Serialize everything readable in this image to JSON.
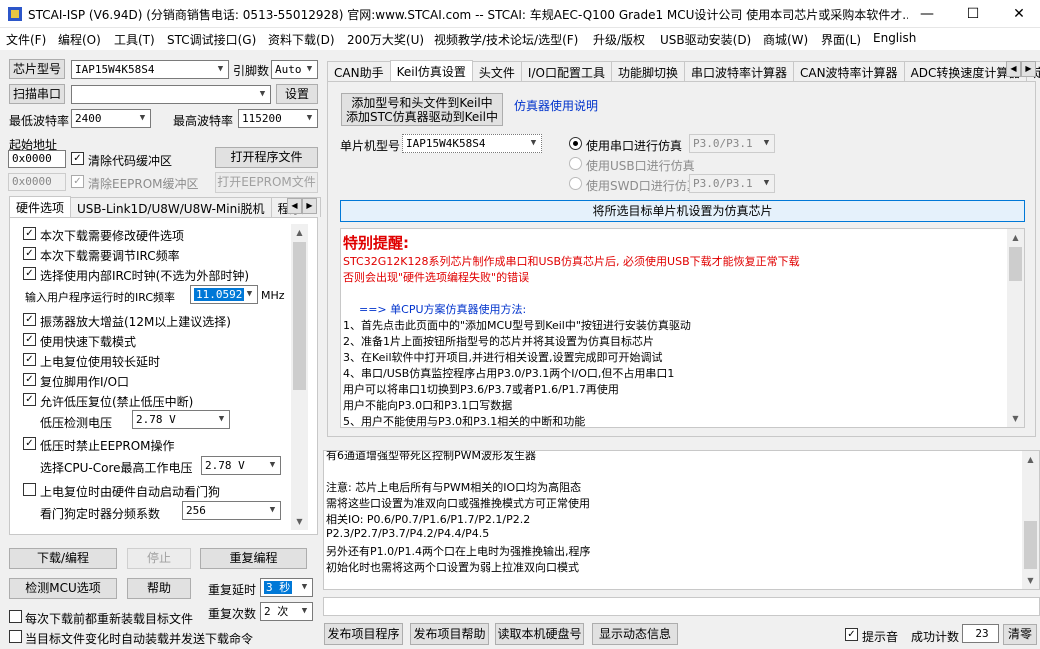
{
  "title": "STCAI-ISP (V6.94D) (分销商销售电话: 0513-55012928) 官网:www.STCAI.com  -- STCAI: 车规AEC-Q100 Grade1 MCU设计公司 使用本司芯片或采购本软件才...",
  "window_buttons": {
    "min": "—",
    "max": "☐",
    "close": "✕"
  },
  "menu": [
    "文件(F)",
    "编程(O)",
    "工具(T)",
    "STC调试接口(G)",
    "资料下载(D)",
    "200万大奖(U)",
    "视频教学/技术论坛/选型(F)",
    "升级/版权",
    "USB驱动安装(D)",
    "商城(W)",
    "界面(L)",
    "English"
  ],
  "left": {
    "chip_label": "芯片型号",
    "chip_value": "IAP15W4K58S4",
    "pin_label": "引脚数",
    "pin_value": "Auto",
    "scan_btn": "扫描串口",
    "port_value": "",
    "settings_btn": "设置",
    "min_baud_label": "最低波特率",
    "min_baud_value": "2400",
    "max_baud_label": "最高波特率",
    "max_baud_value": "115200",
    "start_addr_label": "起始地址",
    "addr1": "0x0000",
    "clear_code": "清除代码缓冲区",
    "open_prog_btn": "打开程序文件",
    "addr2": "0x0000",
    "clear_eeprom": "清除EEPROM缓冲区",
    "open_eeprom_btn": "打开EEPROM文件",
    "tabs": [
      "硬件选项",
      "USB-Link1D/U8W/U8W-Mini脱机",
      "程序加"
    ],
    "hw": {
      "opt1": "本次下载需要修改硬件选项",
      "opt2": "本次下载需要调节IRC频率",
      "opt3": "选择使用内部IRC时钟(不选为外部时钟)",
      "irc_label": "输入用户程序运行时的IRC频率",
      "irc_value": "11.0592",
      "irc_unit": "MHz",
      "opt4": "振荡器放大增益(12M以上建议选择)",
      "opt5": "使用快速下载模式",
      "opt6": "上电复位使用较长延时",
      "opt7": "复位脚用作I/O口",
      "opt8": "允许低压复位(禁止低压中断)",
      "lv_label": "低压检测电压",
      "lv_value": "2.78 V",
      "opt9": "低压时禁止EEPROM操作",
      "cpu_label": "选择CPU-Core最高工作电压",
      "cpu_value": "2.78 V",
      "opt10": "上电复位时由硬件自动启动看门狗",
      "wdt_label": "看门狗定时器分频系数",
      "wdt_value": "256"
    },
    "download_btn": "下载/编程",
    "stop_btn": "停止",
    "reprog_btn": "重复编程",
    "detect_btn": "检测MCU选项",
    "help_btn": "帮助",
    "delay_label": "重复延时",
    "delay_value": "3 秒",
    "count_label": "重复次数",
    "count_value": "2 次",
    "reload1": "每次下载前都重新装载目标文件",
    "reload2": "当目标文件变化时自动装载并发送下载命令"
  },
  "right": {
    "tabs": [
      "CAN助手",
      "Keil仿真设置",
      "头文件",
      "I/O口配置工具",
      "功能脚切换",
      "串口波特率计算器",
      "CAN波特率计算器",
      "ADC转换速度计算器",
      "定"
    ],
    "add_keil_line1": "添加型号和头文件到Keil中",
    "add_keil_line2": "添加STC仿真器驱动到Keil中",
    "emu_help_link": "仿真器使用说明",
    "mcu_label": "单片机型号",
    "mcu_value": "IAP15W4K58S4",
    "r_uart": "使用串口进行仿真",
    "r_uart_val": "P3.0/P3.1",
    "r_usb": "使用USB口进行仿真",
    "r_swd": "使用SWD口进行仿真",
    "r_swd_val": "P3.0/P3.1",
    "set_target_btn": "将所选目标单片机设置为仿真芯片",
    "notice_title": "特别提醒:",
    "notice_red1": "STC32G12K128系列芯片制作成串口和USB仿真芯片后, 必须使用USB下载才能恢复正常下载",
    "notice_red2": "否则会出现\"硬件选项编程失败\"的错误",
    "cpu_title": "==> 单CPU方案仿真器使用方法:",
    "steps": [
      "1、首先点击此页面中的\"添加MCU型号到Keil中\"按钮进行安装仿真驱动",
      "2、准备1片上面按钮所指型号的芯片并将其设置为仿真目标芯片",
      "3、在Keil软件中打开项目,并进行相关设置,设置完成即可开始调试",
      "4、串口/USB仿真监控程序占用P3.0/P3.1两个I/O口,但不占用串口1",
      "    用户可以将串口1切换到P3.6/P3.7或者P1.6/P1.7再使用",
      "    用户不能向P3.0口和P3.1口写数据",
      "5、用户不能使用与P3.0和P3.1相关的中断和功能"
    ],
    "log": [
      "有6通道增强型带死区控制PWM波形发生器",
      "",
      "注意: 芯片上电后所有与PWM相关的IO口均为高阻态",
      "      需将这些口设置为准双向口或强推挽模式方可正常使用",
      "相关IO: P0.6/P0.7/P1.6/P1.7/P2.1/P2.2",
      "        P2.3/P2.7/P3.7/P4.2/P4.4/P4.5",
      "另外还有P1.0/P1.4两个口在上电时为强推挽输出,程序",
      "    初始化时也需将这两个口设置为弱上拉准双向口模式"
    ],
    "publish_btn": "发布项目程序",
    "publish_help_btn": "发布项目帮助",
    "read_disk_btn": "读取本机硬盘号",
    "show_dyn_btn": "显示动态信息",
    "tips_label": "提示音",
    "success_label": "成功计数",
    "success_value": "23",
    "clear_btn": "清零"
  }
}
